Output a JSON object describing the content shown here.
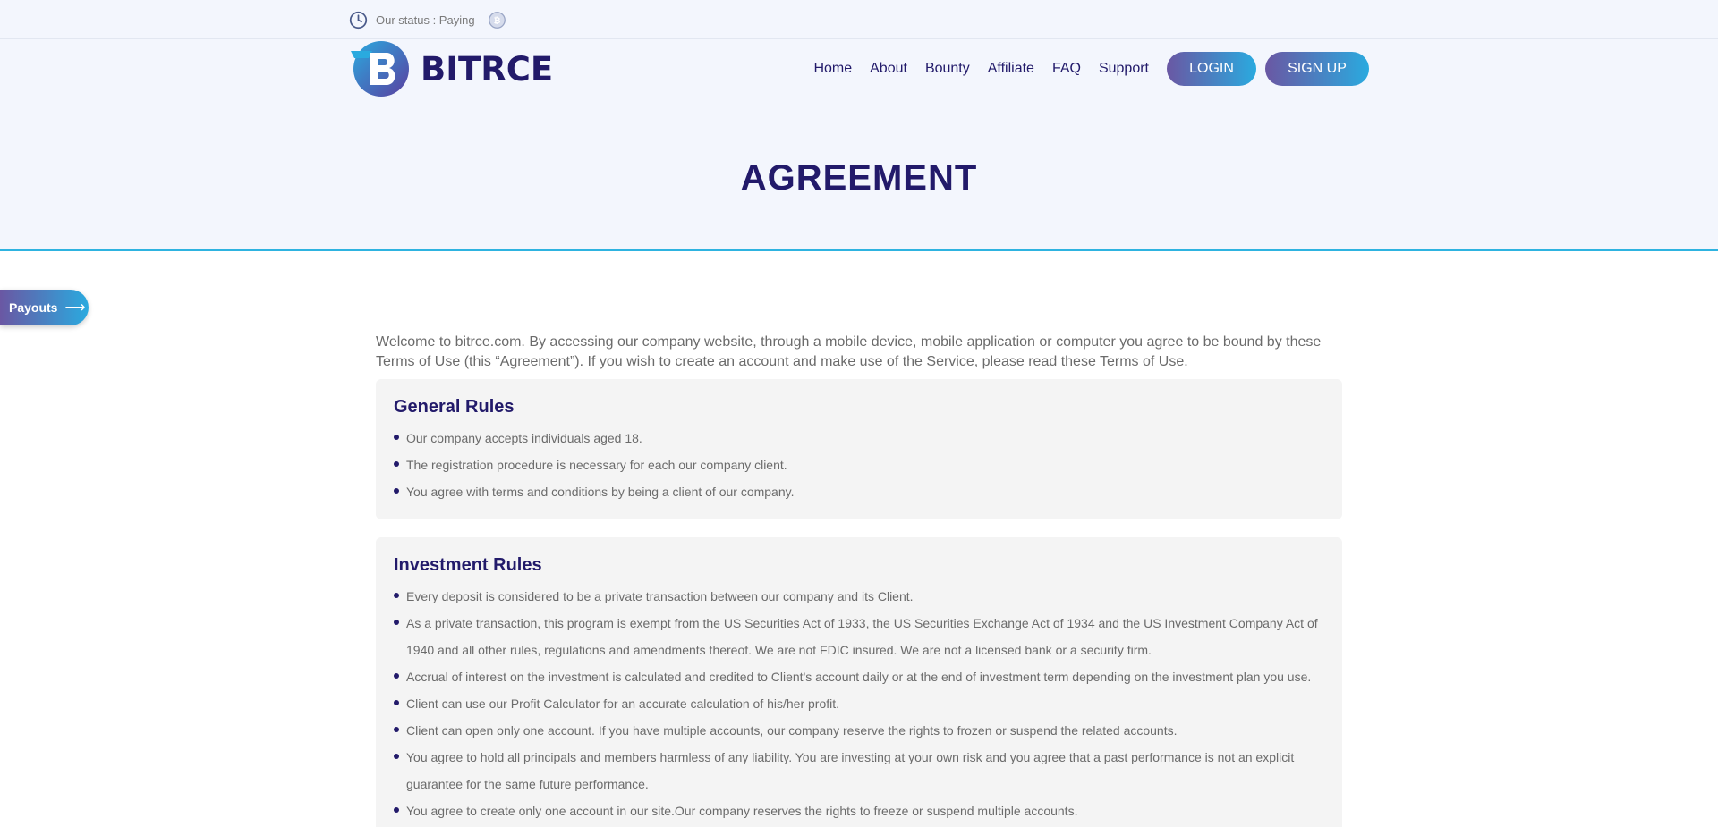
{
  "topbar": {
    "status_text": "Our status : Paying"
  },
  "brand": {
    "name": "BITRCE"
  },
  "nav": {
    "links": [
      "Home",
      "About",
      "Bounty",
      "Affiliate",
      "FAQ",
      "Support"
    ],
    "login_label": "LOGIN",
    "signup_label": "SIGN UP"
  },
  "page": {
    "title": "AGREEMENT"
  },
  "payouts": {
    "label": "Payouts"
  },
  "intro": "Welcome to bitrce.com. By accessing our company website, through a mobile device, mobile application or computer you agree to be bound by these Terms of Use (this “Agreement”). If you wish to create an account and make use of the Service, please read these Terms of Use.",
  "sections": [
    {
      "title": "General Rules",
      "items": [
        "Our company accepts individuals aged 18.",
        "The registration procedure is necessary for each our company client.",
        "You agree with terms and conditions by being a client of our company."
      ]
    },
    {
      "title": "Investment Rules",
      "items": [
        "Every deposit is considered to be a private transaction between our company and its Client.",
        "As a private transaction, this program is exempt from the US Securities Act of 1933, the US Securities Exchange Act of 1934 and the US Investment Company Act of 1940 and all other rules, regulations and amendments thereof. We are not FDIC insured. We are not a licensed bank or a security firm.",
        "Accrual of interest on the investment is calculated and credited to Client's account daily or at the end of investment term depending on the investment plan you use.",
        "Client can use our Profit Calculator for an accurate calculation of his/her profit.",
        "Client can open only one account. If you have multiple accounts, our company reserve the rights to frozen or suspend the related accounts.",
        "You agree to hold all principals and members harmless of any liability. You are investing at your own risk and you agree that a past performance is not an explicit guarantee for the same future performance.",
        "You agree to create only one account in our site.Our company reserves the rights to freeze or suspend multiple accounts."
      ]
    }
  ],
  "colors": {
    "navy": "#221a6a",
    "accent_start": "#6a57a3",
    "accent_end": "#2aaadf",
    "hero_bg": "#f3f6fd",
    "card_bg": "#f4f4f4"
  }
}
